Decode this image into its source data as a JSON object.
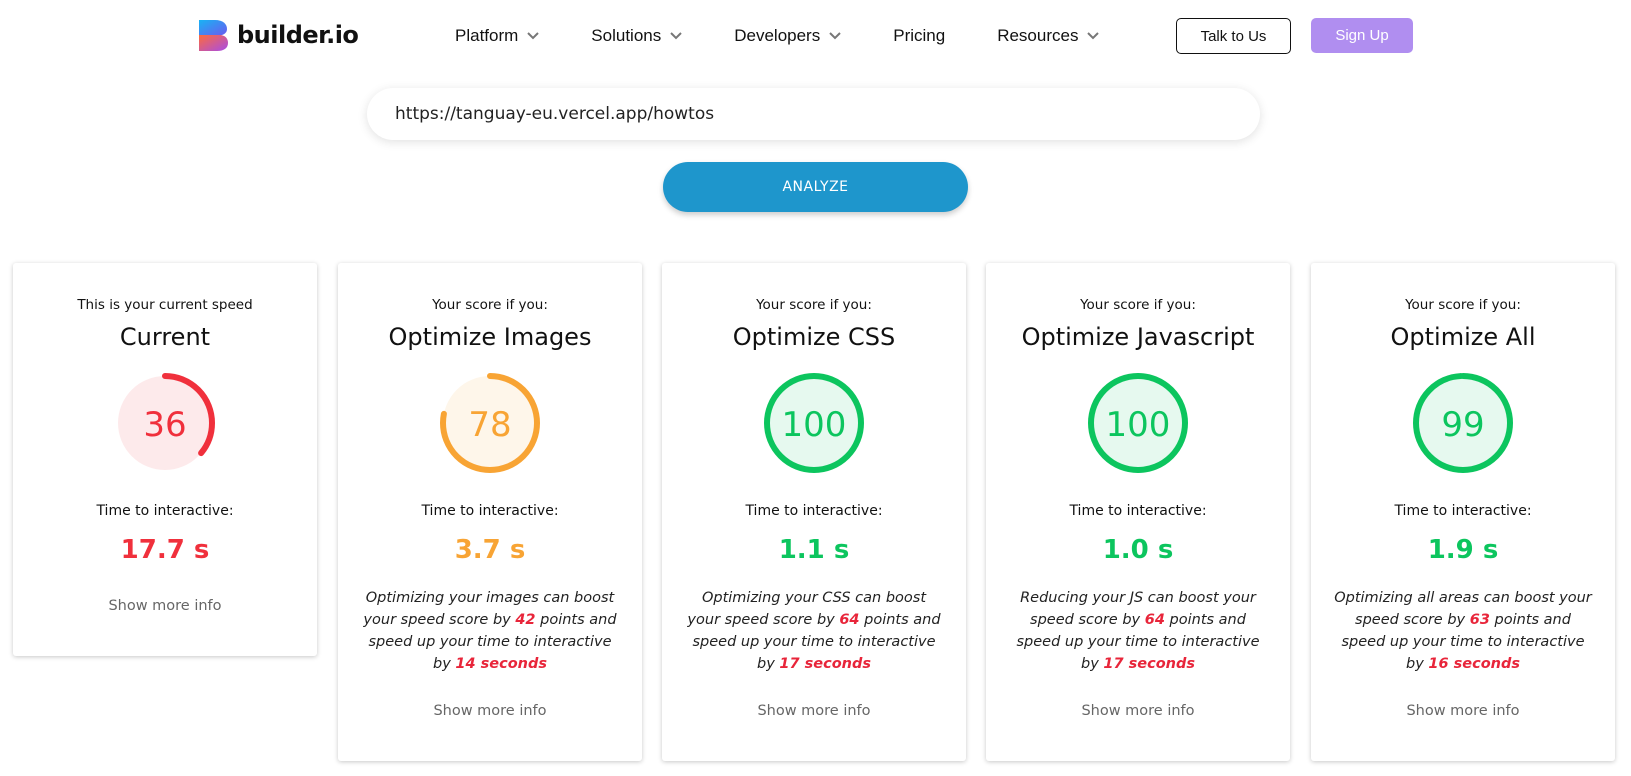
{
  "brand": {
    "name": "builder.io"
  },
  "nav": {
    "items": [
      {
        "label": "Platform",
        "has_dropdown": true
      },
      {
        "label": "Solutions",
        "has_dropdown": true
      },
      {
        "label": "Developers",
        "has_dropdown": true
      },
      {
        "label": "Pricing",
        "has_dropdown": false
      },
      {
        "label": "Resources",
        "has_dropdown": true
      }
    ],
    "talk_label": "Talk to Us",
    "signup_label": "Sign Up"
  },
  "analyzer": {
    "url_value": "https://tanguay-eu.vercel.app/howtos",
    "analyze_label": "ANALYZE"
  },
  "colors": {
    "red": "#f0303c",
    "orange": "#f8a434",
    "green": "#0cc55e",
    "brand_purple": "#b08ef0",
    "analyze_blue": "#1e96cc"
  },
  "cards": [
    {
      "subtitle": "This is your current speed",
      "title": "Current",
      "score": 36,
      "score_color": "red",
      "tti_label": "Time to interactive:",
      "tti_value": "17.7 s",
      "desc": [],
      "more_label": "Show more info"
    },
    {
      "subtitle": "Your score if you:",
      "title": "Optimize Images",
      "score": 78,
      "score_color": "orange",
      "tti_label": "Time to interactive:",
      "tti_value": "3.7 s",
      "desc": [
        {
          "t": "Optimizing your images can boost your speed score by "
        },
        {
          "t": "42",
          "hl": true
        },
        {
          "t": " points and speed up your time to interactive by "
        },
        {
          "t": "14 seconds",
          "hl": true
        }
      ],
      "more_label": "Show more info"
    },
    {
      "subtitle": "Your score if you:",
      "title": "Optimize CSS",
      "score": 100,
      "score_color": "green",
      "tti_label": "Time to interactive:",
      "tti_value": "1.1 s",
      "desc": [
        {
          "t": "Optimizing your CSS can boost your speed score by "
        },
        {
          "t": "64",
          "hl": true
        },
        {
          "t": " points and speed up your time to interactive by "
        },
        {
          "t": "17 seconds",
          "hl": true
        }
      ],
      "more_label": "Show more info"
    },
    {
      "subtitle": "Your score if you:",
      "title": "Optimize Javascript",
      "score": 100,
      "score_color": "green",
      "tti_label": "Time to interactive:",
      "tti_value": "1.0 s",
      "desc": [
        {
          "t": "Reducing your JS can boost your speed score by "
        },
        {
          "t": "64",
          "hl": true
        },
        {
          "t": " points and speed up your time to interactive by "
        },
        {
          "t": "17 seconds",
          "hl": true
        }
      ],
      "more_label": "Show more info"
    },
    {
      "subtitle": "Your score if you:",
      "title": "Optimize All",
      "score": 99,
      "score_color": "green",
      "tti_label": "Time to interactive:",
      "tti_value": "1.9 s",
      "desc": [
        {
          "t": "Optimizing all areas can boost your speed score by "
        },
        {
          "t": "63",
          "hl": true
        },
        {
          "t": " points and speed up your time to interactive by "
        },
        {
          "t": "16 seconds",
          "hl": true
        }
      ],
      "more_label": "Show more info"
    }
  ]
}
